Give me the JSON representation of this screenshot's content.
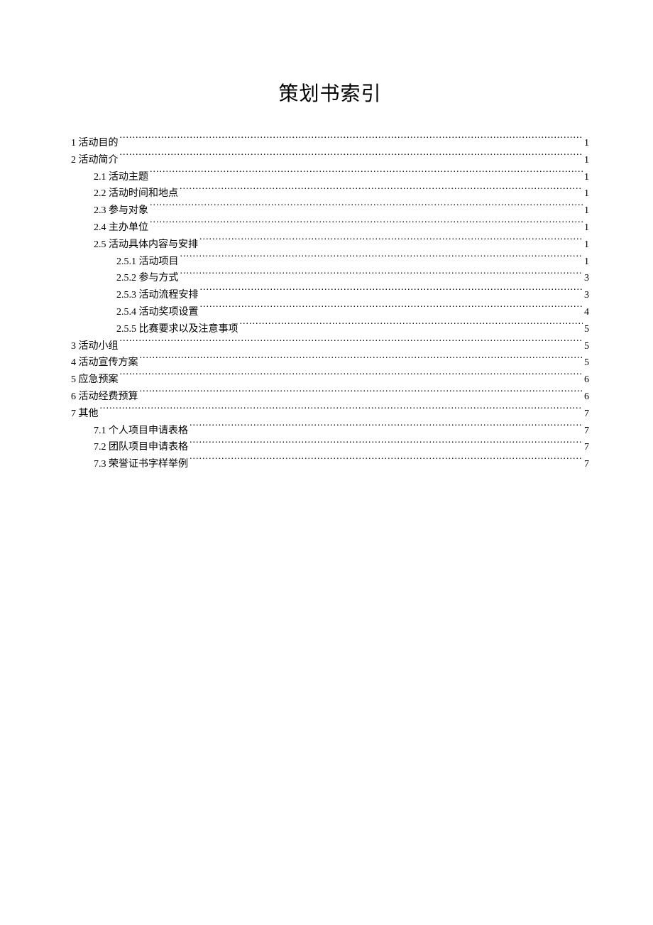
{
  "title": "策划书索引",
  "toc": [
    {
      "level": 1,
      "label": "1  活动目的",
      "page": "1"
    },
    {
      "level": 1,
      "label": "2  活动简介",
      "page": "1"
    },
    {
      "level": 2,
      "label": "2.1  活动主题",
      "page": "1"
    },
    {
      "level": 2,
      "label": "2.2  活动时间和地点",
      "page": "1"
    },
    {
      "level": 2,
      "label": "2.3  参与对象",
      "page": "1"
    },
    {
      "level": 2,
      "label": "2.4  主办单位",
      "page": "1"
    },
    {
      "level": 2,
      "label": "2.5  活动具体内容与安排",
      "page": "1"
    },
    {
      "level": 3,
      "label": "2.5.1 活动项目",
      "page": "1"
    },
    {
      "level": 3,
      "label": "2.5.2  参与方式",
      "page": "3"
    },
    {
      "level": 3,
      "label": "2.5.3  活动流程安排",
      "page": "3"
    },
    {
      "level": 3,
      "label": "2.5.4  活动奖项设置",
      "page": "4"
    },
    {
      "level": 3,
      "label": "2.5.5  比赛要求以及注意事项",
      "page": "5"
    },
    {
      "level": 1,
      "label": "3  活动小组",
      "page": "5"
    },
    {
      "level": 1,
      "label": "4  活动宣传方案",
      "page": "5"
    },
    {
      "level": 1,
      "label": "5 应急预案",
      "page": "6"
    },
    {
      "level": 1,
      "label": "6 活动经费预算",
      "page": "6"
    },
    {
      "level": 1,
      "label": "7  其他",
      "page": "7"
    },
    {
      "level": 2,
      "label": "7.1  个人项目申请表格",
      "page": "7"
    },
    {
      "level": 2,
      "label": "7.2  团队项目申请表格",
      "page": "7"
    },
    {
      "level": 2,
      "label": "7.3 荣誉证书字样举例",
      "page": "7"
    }
  ]
}
